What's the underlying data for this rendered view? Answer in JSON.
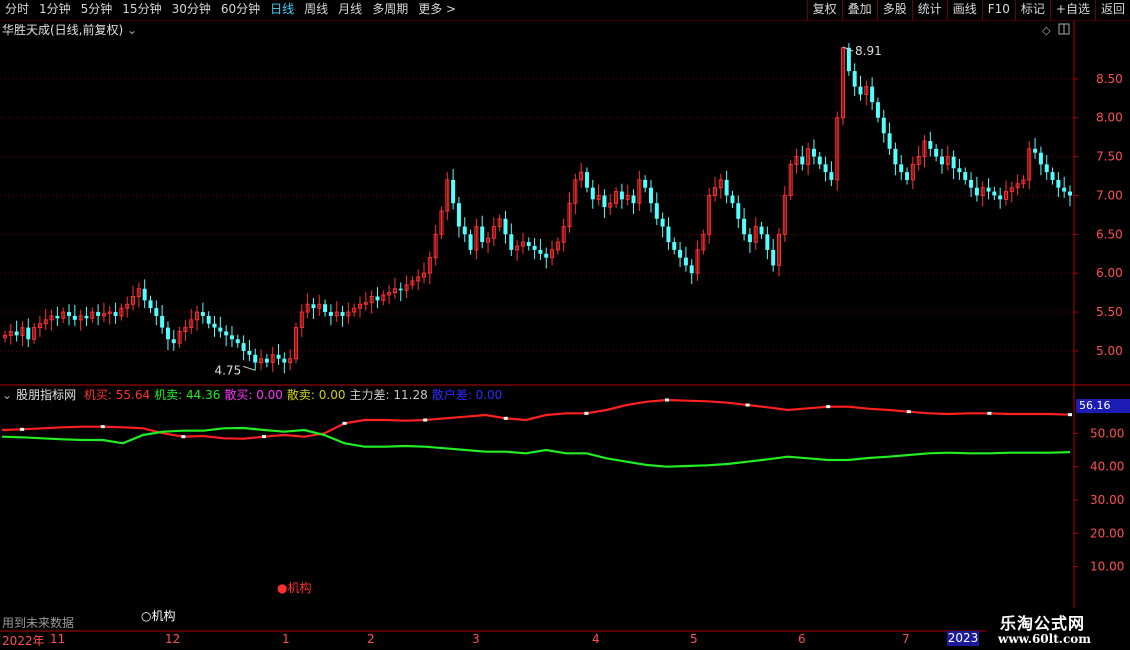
{
  "toolbar": {
    "periods": [
      "分时",
      "1分钟",
      "5分钟",
      "15分钟",
      "30分钟",
      "60分钟",
      "日线",
      "周线",
      "月线",
      "多周期",
      "更多 >"
    ],
    "active_period": "日线",
    "tools": [
      "复权",
      "叠加",
      "多股",
      "统计",
      "画线",
      "F10",
      "标记",
      "+自选",
      "返回"
    ]
  },
  "stock": {
    "title": "华胜天成(日线,前复权)"
  },
  "indicator": {
    "name": "股朋指标网",
    "items": [
      {
        "label": "机买: 55.64",
        "color": "#ff3030"
      },
      {
        "label": "机卖: 44.36",
        "color": "#22ee22"
      },
      {
        "label": "散买: 0.00",
        "color": "#ff33ff"
      },
      {
        "label": "散卖: 0.00",
        "color": "#d4d400"
      },
      {
        "label": "主力差: 11.28",
        "color": "#c8c8c8"
      },
      {
        "label": "散户差: 0.00",
        "color": "#2a2aff"
      }
    ],
    "current_label": "56.16"
  },
  "price_axis": [
    "8.50",
    "8.00",
    "7.50",
    "7.00",
    "6.50",
    "6.00",
    "5.50",
    "5.00"
  ],
  "ind_axis": [
    "50.00",
    "40.00",
    "30.00",
    "20.00",
    "10.00"
  ],
  "annotations": {
    "high": "8.91",
    "low": "4.75",
    "red_mark": "机构",
    "white_mark": "机构",
    "note": "用到未来数据"
  },
  "time_axis": [
    "2022年",
    "11",
    "12",
    "1",
    "2",
    "3",
    "4",
    "5",
    "6",
    "7",
    "2023"
  ],
  "brand": {
    "name": "乐淘公式网",
    "url": "www.60lt.com"
  },
  "colors": {
    "up": "#ff3030",
    "down": "#54ffff",
    "buy_line": "#ff2020",
    "sell_line": "#22ee22",
    "axis": "#b40000",
    "grid": "#6a0000"
  },
  "chart_data": [
    {
      "type": "candlestick",
      "title": "华胜天成(日线,前复权)",
      "yrange": [
        4.6,
        9.0
      ],
      "high_label": 8.91,
      "low_label": 4.75,
      "closes": [
        5.2,
        5.25,
        5.2,
        5.3,
        5.15,
        5.3,
        5.35,
        5.4,
        5.45,
        5.42,
        5.5,
        5.45,
        5.4,
        5.45,
        5.42,
        5.5,
        5.45,
        5.48,
        5.5,
        5.45,
        5.55,
        5.6,
        5.7,
        5.8,
        5.65,
        5.55,
        5.45,
        5.3,
        5.15,
        5.1,
        5.25,
        5.3,
        5.4,
        5.5,
        5.45,
        5.35,
        5.3,
        5.25,
        5.2,
        5.15,
        5.1,
        5.0,
        4.95,
        4.85,
        4.9,
        4.85,
        4.95,
        4.9,
        4.85,
        4.9,
        5.3,
        5.5,
        5.6,
        5.55,
        5.6,
        5.5,
        5.45,
        5.5,
        5.45,
        5.5,
        5.55,
        5.6,
        5.62,
        5.7,
        5.65,
        5.72,
        5.75,
        5.8,
        5.78,
        5.85,
        5.9,
        5.95,
        6.0,
        6.2,
        6.5,
        6.8,
        7.2,
        6.9,
        6.6,
        6.5,
        6.3,
        6.6,
        6.4,
        6.45,
        6.6,
        6.7,
        6.5,
        6.3,
        6.35,
        6.4,
        6.35,
        6.3,
        6.25,
        6.2,
        6.3,
        6.4,
        6.6,
        6.9,
        7.2,
        7.3,
        7.1,
        6.95,
        7.0,
        6.85,
        6.9,
        7.05,
        6.95,
        7.0,
        6.9,
        7.2,
        7.1,
        6.9,
        6.7,
        6.6,
        6.4,
        6.3,
        6.2,
        6.1,
        6.0,
        6.3,
        6.5,
        7.0,
        7.1,
        7.2,
        7.0,
        6.9,
        6.7,
        6.5,
        6.4,
        6.6,
        6.5,
        6.3,
        6.1,
        6.5,
        7.0,
        7.4,
        7.5,
        7.4,
        7.6,
        7.5,
        7.4,
        7.3,
        7.2,
        8.0,
        8.9,
        8.6,
        8.4,
        8.3,
        8.4,
        8.2,
        8.0,
        7.8,
        7.6,
        7.4,
        7.3,
        7.2,
        7.4,
        7.5,
        7.7,
        7.6,
        7.5,
        7.4,
        7.5,
        7.35,
        7.3,
        7.2,
        7.1,
        7.0,
        7.1,
        7.05,
        7.0,
        6.95,
        7.05,
        7.1,
        7.15,
        7.2,
        7.6,
        7.55,
        7.4,
        7.3,
        7.2,
        7.1,
        7.05,
        7.0
      ]
    },
    {
      "type": "line",
      "yrange": [
        0,
        60
      ],
      "series": [
        {
          "name": "机买",
          "values": [
            51,
            51.2,
            51.5,
            51.8,
            52,
            52,
            51.8,
            51.5,
            50,
            49,
            49.2,
            48.5,
            48.4,
            49,
            49.5,
            49,
            50,
            53,
            54,
            54,
            53.8,
            54,
            54.5,
            55,
            55.5,
            54.5,
            54,
            55.5,
            56,
            56,
            57,
            58.5,
            59.5,
            60,
            59.8,
            59.6,
            59.2,
            58.5,
            57.8,
            57,
            57.5,
            58,
            58,
            57.4,
            57,
            56.5,
            56,
            55.8,
            56,
            56,
            55.8,
            55.8,
            55.8,
            55.6
          ]
        },
        {
          "name": "机卖",
          "values": [
            49,
            48.8,
            48.5,
            48.2,
            48,
            48,
            47,
            49.5,
            50.5,
            50.8,
            50.8,
            51.5,
            51.6,
            51,
            50.5,
            51,
            49.5,
            47,
            46,
            46,
            46.2,
            46,
            45.5,
            45,
            44.5,
            44.5,
            44,
            45,
            44,
            44,
            42.5,
            41.5,
            40.5,
            40,
            40.2,
            40.4,
            40.8,
            41.5,
            42.2,
            43,
            42.5,
            42,
            42,
            42.6,
            43,
            43.5,
            44,
            44.2,
            44,
            44,
            44.2,
            44.2,
            44.2,
            44.36
          ]
        }
      ]
    }
  ]
}
